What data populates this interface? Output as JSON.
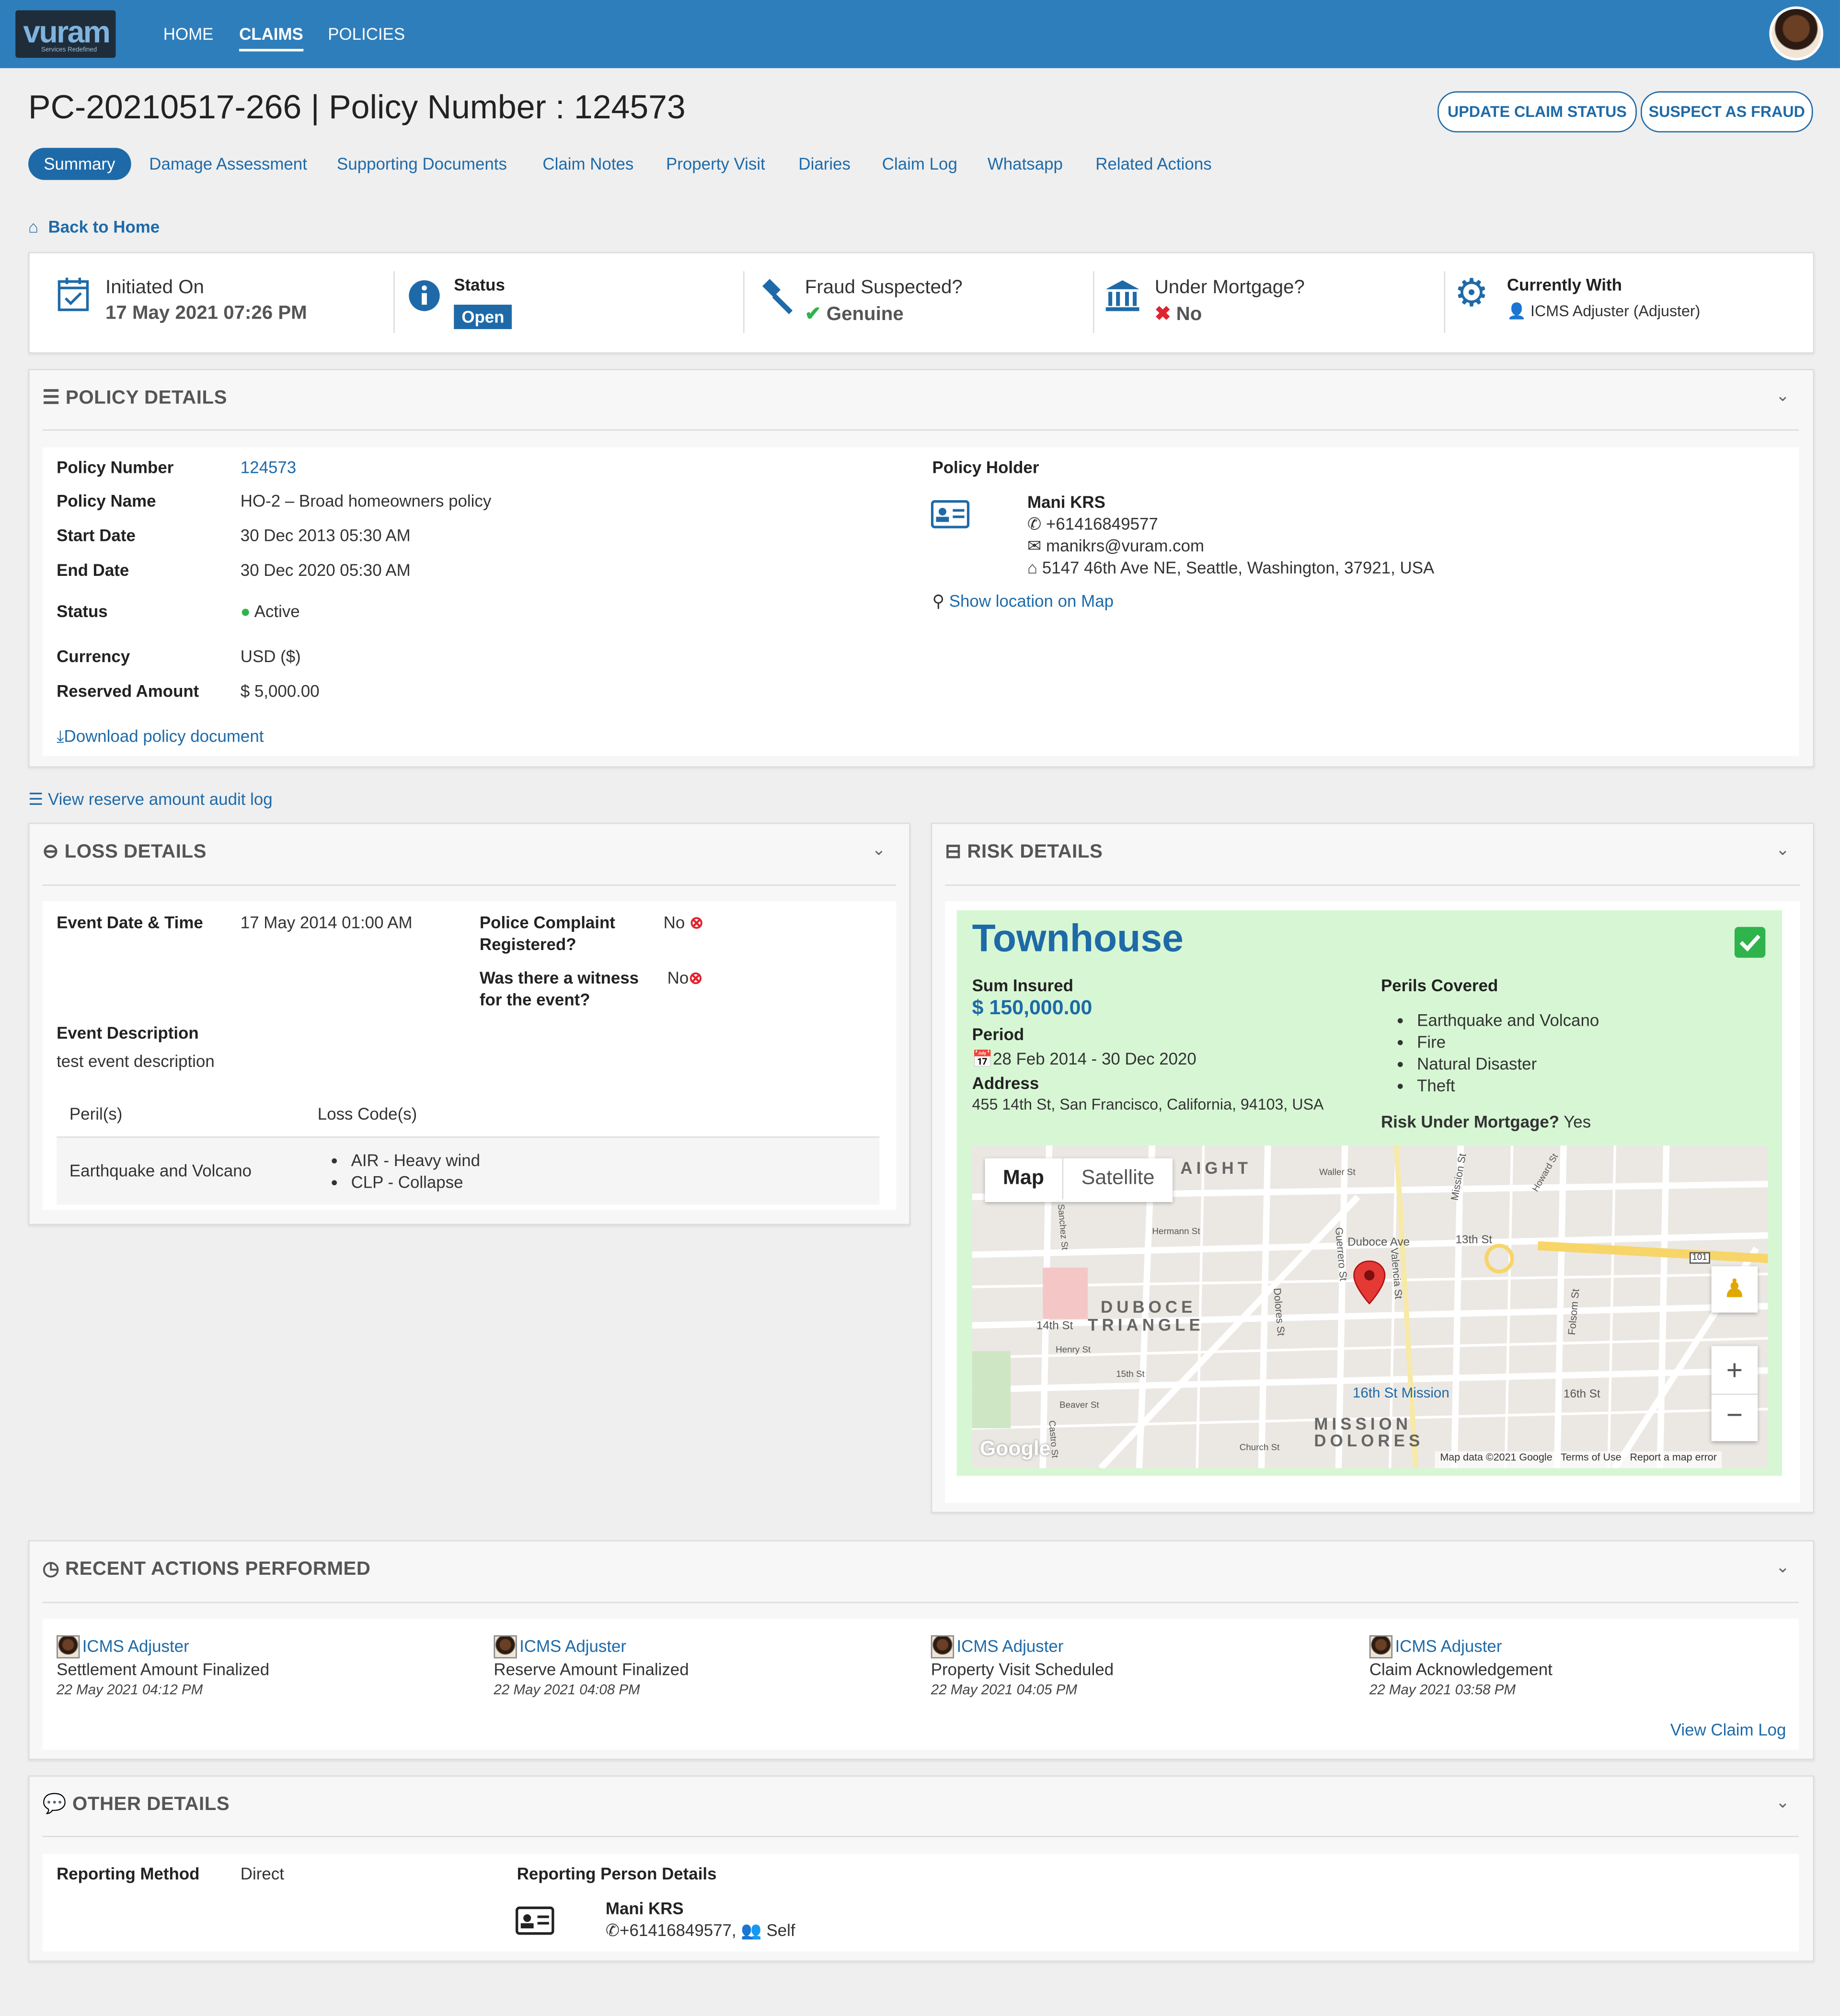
{
  "header": {
    "logo": "vuram",
    "logo_tagline": "Services Redefined",
    "nav": [
      "HOME",
      "CLAIMS",
      "POLICIES"
    ],
    "active_nav": "CLAIMS"
  },
  "page": {
    "title": "PC-20210517-266 | Policy Number : 124573",
    "actions": [
      "UPDATE CLAIM STATUS",
      "SUSPECT AS FRAUD"
    ],
    "tabs": [
      "Summary",
      "Damage Assessment",
      "Supporting Documents",
      "Claim Notes",
      "Property Visit",
      "Diaries",
      "Claim Log",
      "Whatsapp",
      "Related Actions"
    ],
    "back_link": "Back to Home"
  },
  "summary": {
    "initiated_label": "Initiated On",
    "initiated_value": "17 May 2021 07:26 PM",
    "status_label": "Status",
    "status_value": "Open",
    "fraud_label": "Fraud Suspected?",
    "fraud_value": "Genuine",
    "mortgage_label": "Under Mortgage?",
    "mortgage_value": "No",
    "with_label": "Currently With",
    "with_value": "ICMS Adjuster (Adjuster)"
  },
  "policy": {
    "heading": "POLICY DETAILS",
    "fields": [
      {
        "label": "Policy Number",
        "value": "124573"
      },
      {
        "label": "Policy Name",
        "value": "HO-2 – Broad homeowners policy"
      },
      {
        "label": "Start Date",
        "value": "30 Dec 2013 05:30 AM"
      },
      {
        "label": "End Date",
        "value": "30 Dec 2020 05:30 AM"
      },
      {
        "label": "Status",
        "value": "Active"
      },
      {
        "label": "Currency",
        "value": "USD ($)"
      },
      {
        "label": "Reserved Amount",
        "value": "$ 5,000.00"
      }
    ],
    "download_link": "Download policy document",
    "holder_label": "Policy Holder",
    "holder_name": "Mani KRS",
    "holder_phone": "+61416849577",
    "holder_email": "manikrs@vuram.com",
    "holder_address": "5147 46th Ave NE, Seattle, Washington, 37921, USA",
    "map_link": "Show location on Map"
  },
  "audit_link": "View reserve amount audit log",
  "loss": {
    "heading": "LOSS DETAILS",
    "event_dt_label": "Event Date & Time",
    "event_dt_value": "17 May 2014 01:00 AM",
    "police_label_1": "Police Complaint",
    "police_label_2": "Registered?",
    "police_value": "No",
    "witness_label_1": "Was there a witness",
    "witness_label_2": "for the event?",
    "witness_value": "No",
    "desc_label": "Event Description",
    "desc_value": "test event description",
    "perils_header": "Peril(s)",
    "codes_header": "Loss Code(s)",
    "peril": "Earthquake and Volcano",
    "codes": [
      "AIR - Heavy wind",
      "CLP - Collapse"
    ]
  },
  "risk": {
    "heading": "RISK DETAILS",
    "type": "Townhouse",
    "sum_label": "Sum Insured",
    "sum_value": "$ 150,000.00",
    "period_label": "Period",
    "period_value": "28 Feb 2014 - 30 Dec 2020",
    "address_label": "Address",
    "address_value": "455 14th St, San Francisco, California, 94103, USA",
    "perils_label": "Perils Covered",
    "perils": [
      "Earthquake and Volcano",
      "Fire",
      "Natural Disaster",
      "Theft"
    ],
    "mortgage_label": "Risk Under Mortgage?",
    "mortgage_value": "Yes",
    "map": {
      "tab_map": "Map",
      "tab_satellite": "Satellite",
      "labels": [
        "AIGHT",
        "DUBOCE",
        "TRIANGLE",
        "MISSION",
        "DOLORES",
        "Duboce Ave",
        "13th St",
        "14th St",
        "15th St",
        "16th St",
        "16th St Mission",
        "Mission St",
        "Valencia St",
        "Guerrero St",
        "Dolores St",
        "Folsom St",
        "Howard St",
        "Hermann St",
        "Henry St",
        "Beaver St",
        "Waller St",
        "Castro St",
        "Church St",
        "Sanchez St",
        "101"
      ],
      "footer": [
        "Map data ©2021 Google",
        "Terms of Use",
        "Report a map error"
      ],
      "google": "Google"
    }
  },
  "recent": {
    "heading": "RECENT ACTIONS PERFORMED",
    "items": [
      {
        "user": "ICMS Adjuster",
        "action": "Settlement Amount Finalized",
        "time": "22 May 2021 04:12 PM"
      },
      {
        "user": "ICMS Adjuster",
        "action": "Reserve Amount Finalized",
        "time": "22 May 2021 04:08 PM"
      },
      {
        "user": "ICMS Adjuster",
        "action": "Property Visit Scheduled",
        "time": "22 May 2021 04:05 PM"
      },
      {
        "user": "ICMS Adjuster",
        "action": "Claim Acknowledgement",
        "time": "22 May 2021 03:58 PM"
      }
    ],
    "view_log": "View Claim Log"
  },
  "other": {
    "heading": "OTHER DETAILS",
    "method_label": "Reporting Method",
    "method_value": "Direct",
    "person_label": "Reporting Person Details",
    "person_name": "Mani KRS",
    "person_phone": "+61416849577,",
    "person_relation": "Self"
  },
  "colors": {
    "topbar": "#2f7ebc",
    "accent": "#1e6aa8",
    "risk_bg": "#d7f7d4",
    "ok": "#2fb34b",
    "no": "#e0232e"
  }
}
